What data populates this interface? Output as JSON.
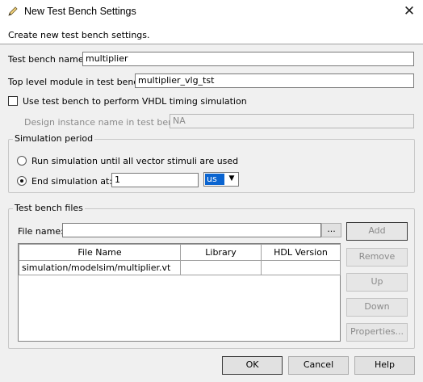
{
  "window": {
    "title": "New Test Bench Settings",
    "close_glyph": "✕",
    "app_icon": "pencil-icon"
  },
  "description": "Create new test bench settings.",
  "form": {
    "testbench_name_label": "Test bench name:",
    "testbench_name_value": "multiplier",
    "top_module_label": "Top level module in test bench:",
    "top_module_value": "multiplier_vlg_tst",
    "vhdl_timing_label": "Use test bench to perform VHDL timing simulation",
    "vhdl_timing_checked": false,
    "design_instance_label": "Design instance name in test bench:",
    "design_instance_value": "NA"
  },
  "simulation_period": {
    "title": "Simulation period",
    "option_run_all": "Run simulation until all vector stimuli are used",
    "option_end_at": "End simulation at:",
    "selected": "end_at",
    "end_value": "1",
    "unit": "us"
  },
  "test_bench_files": {
    "title": "Test bench files",
    "file_name_label": "File name:",
    "file_name_value": "",
    "browse_label": "...",
    "columns": [
      "File Name",
      "Library",
      "HDL Version"
    ],
    "rows": [
      [
        "simulation/modelsim/multiplier.vt",
        "",
        ""
      ]
    ],
    "buttons": {
      "add": "Add",
      "remove": "Remove",
      "up": "Up",
      "down": "Down",
      "properties": "Properties..."
    }
  },
  "footer": {
    "ok": "OK",
    "cancel": "Cancel",
    "help": "Help"
  },
  "colors": {
    "accent_selection": "#0a64d0",
    "dialog_bg": "#f0f0f0"
  }
}
